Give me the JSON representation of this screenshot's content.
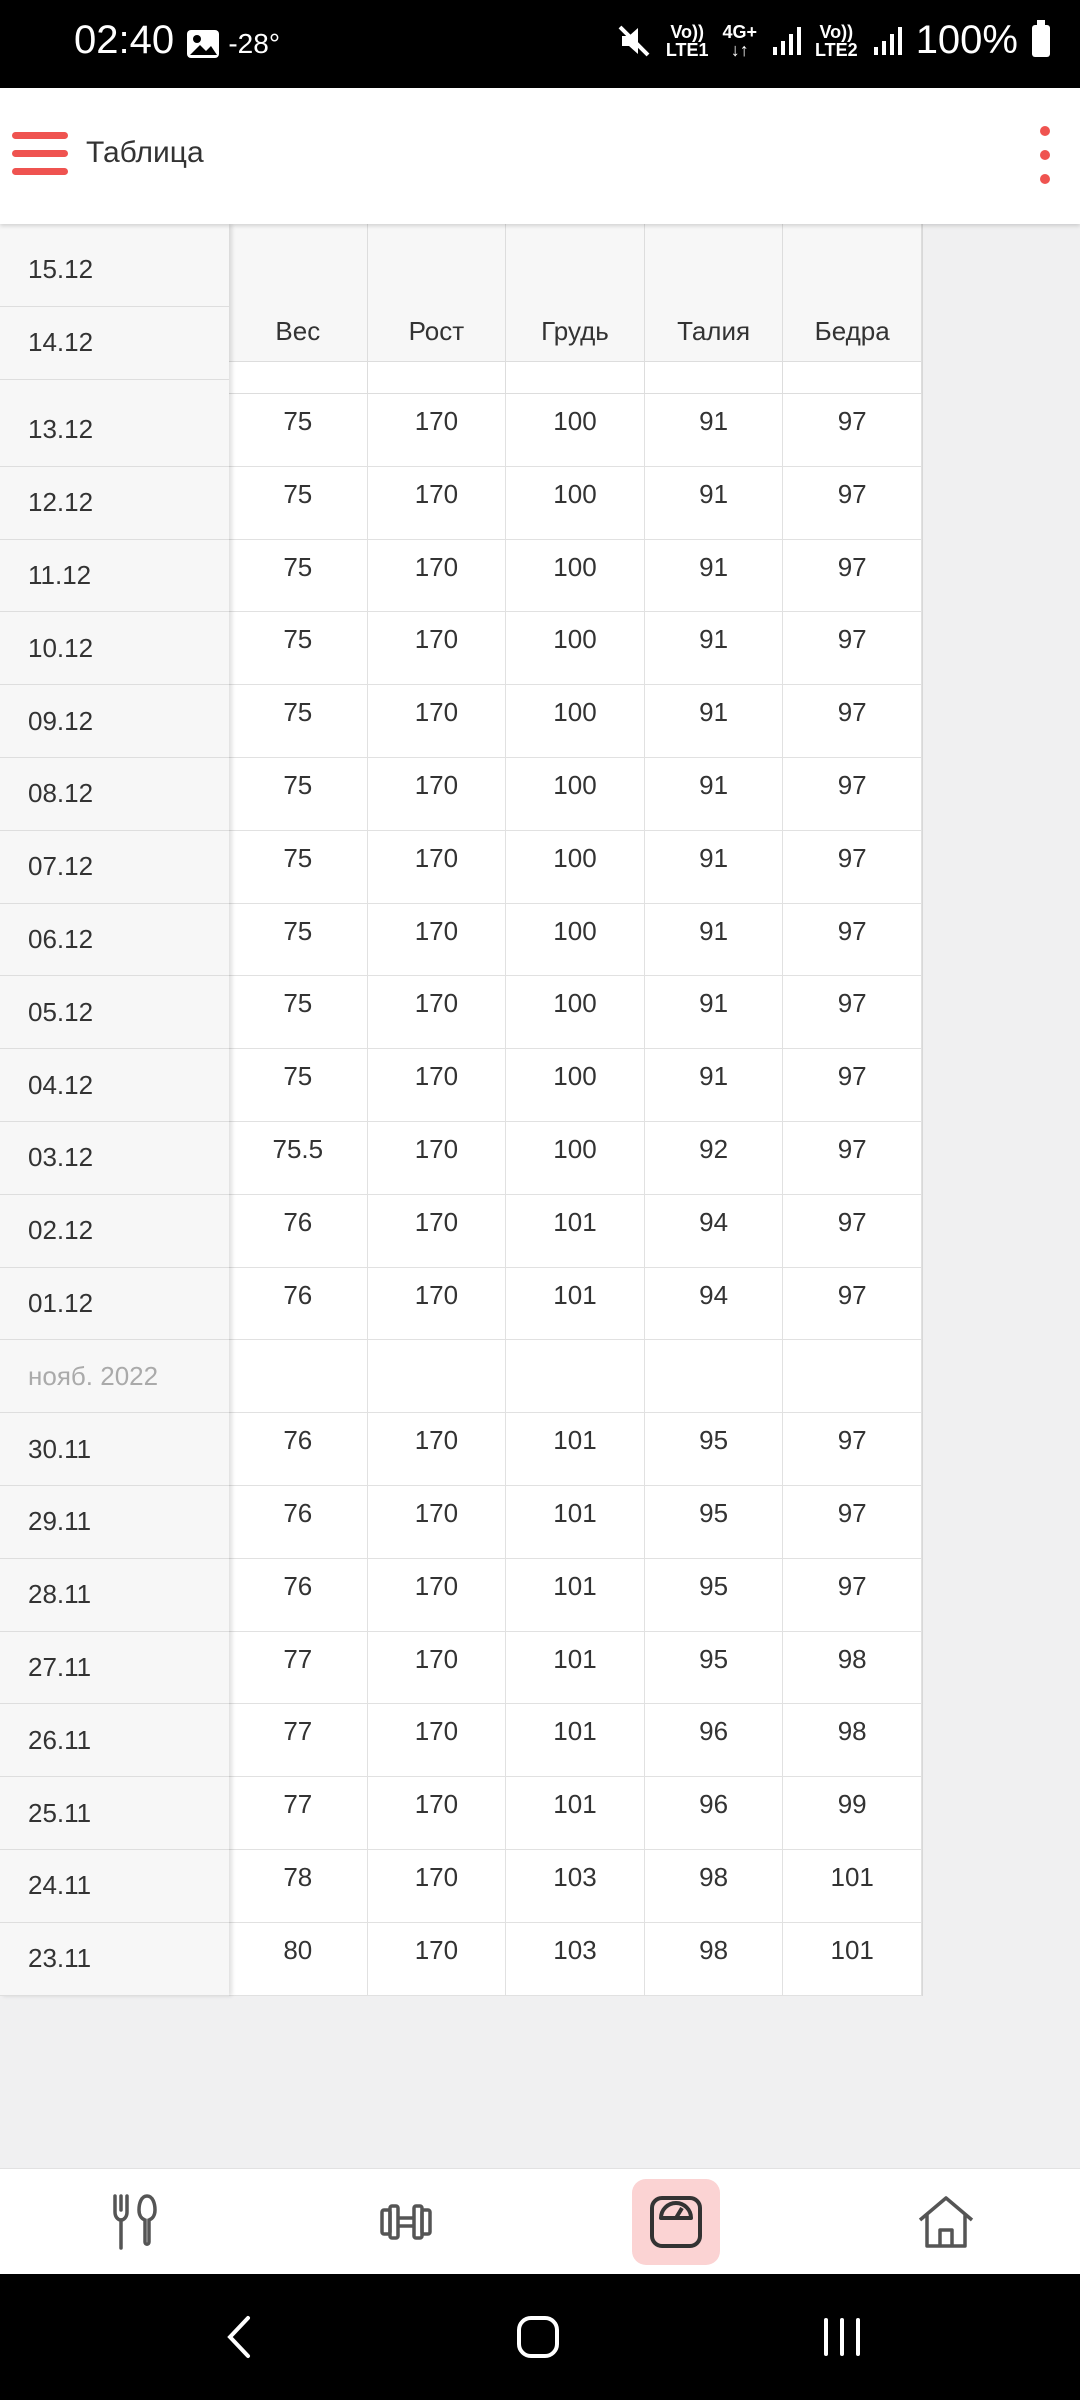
{
  "status_bar": {
    "time": "02:40",
    "temp": "-28°",
    "lte1": "LTE1",
    "lte2": "LTE2",
    "net": "4G+",
    "battery": "100%"
  },
  "app_bar": {
    "title": "Таблица"
  },
  "table": {
    "columns": [
      "Вес",
      "Рост",
      "Грудь",
      "Талия",
      "Бедра"
    ],
    "top_dates": [
      "15.12",
      "14.12"
    ],
    "rows": [
      {
        "date": "13.12",
        "values": [
          "75",
          "170",
          "100",
          "91",
          "97"
        ]
      },
      {
        "date": "12.12",
        "values": [
          "75",
          "170",
          "100",
          "91",
          "97"
        ]
      },
      {
        "date": "11.12",
        "values": [
          "75",
          "170",
          "100",
          "91",
          "97"
        ]
      },
      {
        "date": "10.12",
        "values": [
          "75",
          "170",
          "100",
          "91",
          "97"
        ]
      },
      {
        "date": "09.12",
        "values": [
          "75",
          "170",
          "100",
          "91",
          "97"
        ]
      },
      {
        "date": "08.12",
        "values": [
          "75",
          "170",
          "100",
          "91",
          "97"
        ]
      },
      {
        "date": "07.12",
        "values": [
          "75",
          "170",
          "100",
          "91",
          "97"
        ]
      },
      {
        "date": "06.12",
        "values": [
          "75",
          "170",
          "100",
          "91",
          "97"
        ]
      },
      {
        "date": "05.12",
        "values": [
          "75",
          "170",
          "100",
          "91",
          "97"
        ]
      },
      {
        "date": "04.12",
        "values": [
          "75",
          "170",
          "100",
          "91",
          "97"
        ]
      },
      {
        "date": "03.12",
        "values": [
          "75.5",
          "170",
          "100",
          "92",
          "97"
        ]
      },
      {
        "date": "02.12",
        "values": [
          "76",
          "170",
          "101",
          "94",
          "97"
        ]
      },
      {
        "date": "01.12",
        "values": [
          "76",
          "170",
          "101",
          "94",
          "97"
        ]
      },
      {
        "date": "нояб. 2022",
        "month": true,
        "values": [
          "",
          "",
          "",
          "",
          ""
        ]
      },
      {
        "date": "30.11",
        "values": [
          "76",
          "170",
          "101",
          "95",
          "97"
        ]
      },
      {
        "date": "29.11",
        "values": [
          "76",
          "170",
          "101",
          "95",
          "97"
        ]
      },
      {
        "date": "28.11",
        "values": [
          "76",
          "170",
          "101",
          "95",
          "97"
        ]
      },
      {
        "date": "27.11",
        "values": [
          "77",
          "170",
          "101",
          "95",
          "98"
        ]
      },
      {
        "date": "26.11",
        "values": [
          "77",
          "170",
          "101",
          "96",
          "98"
        ]
      },
      {
        "date": "25.11",
        "values": [
          "77",
          "170",
          "101",
          "96",
          "99"
        ]
      },
      {
        "date": "24.11",
        "values": [
          "78",
          "170",
          "103",
          "98",
          "101"
        ]
      },
      {
        "date": "23.11",
        "values": [
          "80",
          "170",
          "103",
          "98",
          "101"
        ]
      }
    ]
  },
  "bottom_nav": [
    {
      "icon": "fork-spoon-icon",
      "active": false
    },
    {
      "icon": "dumbbell-icon",
      "active": false
    },
    {
      "icon": "scale-icon",
      "active": true
    },
    {
      "icon": "home-icon",
      "active": false
    }
  ],
  "colors": {
    "accent": "#ef5350",
    "active_bg": "#fbd3d3"
  }
}
